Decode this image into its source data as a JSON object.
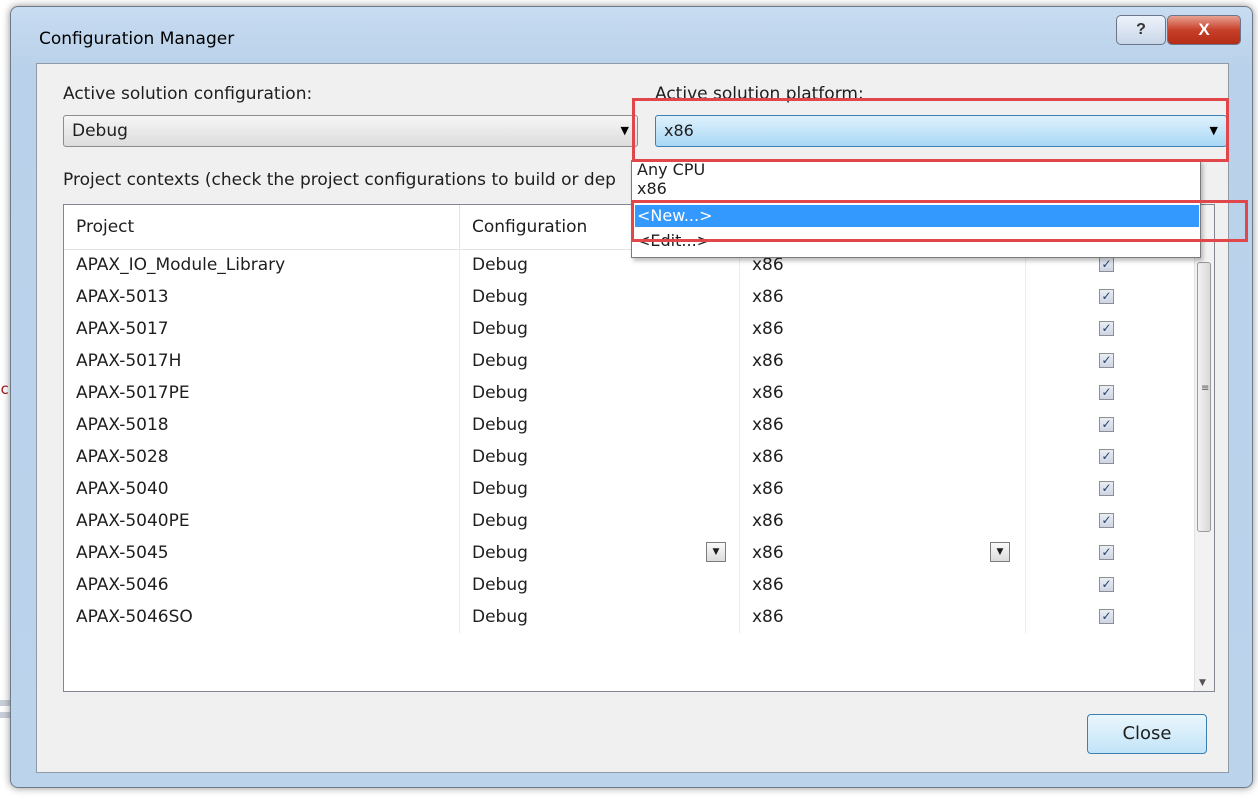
{
  "window": {
    "title": "Configuration Manager",
    "help_glyph": "?",
    "close_glyph": "X"
  },
  "active_config": {
    "label": "Active solution configuration:",
    "value": "Debug"
  },
  "active_platform": {
    "label": "Active solution platform:",
    "value": "x86"
  },
  "platform_options": [
    "Any CPU",
    "x86",
    "<New...>",
    "<Edit...>"
  ],
  "project_contexts_label": "Project contexts (check the project configurations to build or dep",
  "grid": {
    "headers": [
      "Project",
      "Configuration"
    ],
    "rows": [
      {
        "project": "APAX_IO_Module_Library",
        "configuration": "Debug",
        "platform": "x86",
        "build": true
      },
      {
        "project": "APAX-5013",
        "configuration": "Debug",
        "platform": "x86",
        "build": true
      },
      {
        "project": "APAX-5017",
        "configuration": "Debug",
        "platform": "x86",
        "build": true
      },
      {
        "project": "APAX-5017H",
        "configuration": "Debug",
        "platform": "x86",
        "build": true
      },
      {
        "project": "APAX-5017PE",
        "configuration": "Debug",
        "platform": "x86",
        "build": true
      },
      {
        "project": "APAX-5018",
        "configuration": "Debug",
        "platform": "x86",
        "build": true
      },
      {
        "project": "APAX-5028",
        "configuration": "Debug",
        "platform": "x86",
        "build": true
      },
      {
        "project": "APAX-5040",
        "configuration": "Debug",
        "platform": "x86",
        "build": true
      },
      {
        "project": "APAX-5040PE",
        "configuration": "Debug",
        "platform": "x86",
        "build": true
      },
      {
        "project": "APAX-5045",
        "configuration": "Debug",
        "platform": "x86",
        "build": true
      },
      {
        "project": "APAX-5046",
        "configuration": "Debug",
        "platform": "x86",
        "build": true
      },
      {
        "project": "APAX-5046SO",
        "configuration": "Debug",
        "platform": "x86",
        "build": true
      }
    ]
  },
  "close_button": "Close",
  "background_text": "ct",
  "colors": {
    "highlight": "#e0464a",
    "selection": "#3399ff",
    "frame": "#b9d1ea"
  }
}
